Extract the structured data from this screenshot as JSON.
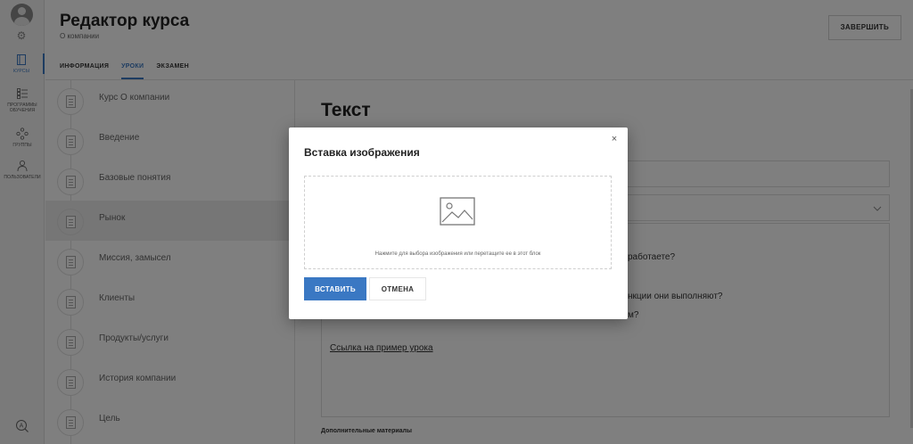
{
  "header": {
    "title": "Редактор курса",
    "subtitle": "О компании",
    "finish_label": "ЗАВЕРШИТЬ"
  },
  "tabs": [
    {
      "label": "ИНФОРМАЦИЯ",
      "active": false
    },
    {
      "label": "УРОКИ",
      "active": true
    },
    {
      "label": "ЭКЗАМЕН",
      "active": false
    }
  ],
  "rail": {
    "items": [
      {
        "label": "КУРСЫ",
        "icon": "book-icon",
        "active": true
      },
      {
        "label": "ПРОГРАММЫ ОБУЧЕНИЯ",
        "icon": "list-icon",
        "active": false
      },
      {
        "label": "ГРУППЫ",
        "icon": "group-icon",
        "active": false
      },
      {
        "label": "ПОЛЬЗОВАТЕЛИ",
        "icon": "users-icon",
        "active": false
      }
    ]
  },
  "lessons": [
    {
      "name": "Курс О компании",
      "active": false
    },
    {
      "name": "Введение",
      "active": false
    },
    {
      "name": "Базовые понятия",
      "active": false
    },
    {
      "name": "Рынок",
      "active": true
    },
    {
      "name": "Миссия, замысел",
      "active": false
    },
    {
      "name": "Клиенты",
      "active": false
    },
    {
      "name": "Продукты/услуги",
      "active": false
    },
    {
      "name": "История компании",
      "active": false
    },
    {
      "name": "Цель",
      "active": false
    }
  ],
  "editor": {
    "title": "Текст",
    "line1": "работаете?",
    "line2": "нкции они выполняют?",
    "line3": "м?",
    "link": "Ссылка на пример урока",
    "extras_label": "Дополнительные материалы"
  },
  "modal": {
    "title": "Вставка изображения",
    "hint": "Нажмите для выбора изображения или перетащите ее в этот блок",
    "insert_label": "ВСТАВИТЬ",
    "cancel_label": "ОТМЕНА",
    "close_glyph": "×"
  },
  "colors": {
    "accent": "#3a78c3",
    "overlay": "rgba(0,0,0,0.5)"
  }
}
